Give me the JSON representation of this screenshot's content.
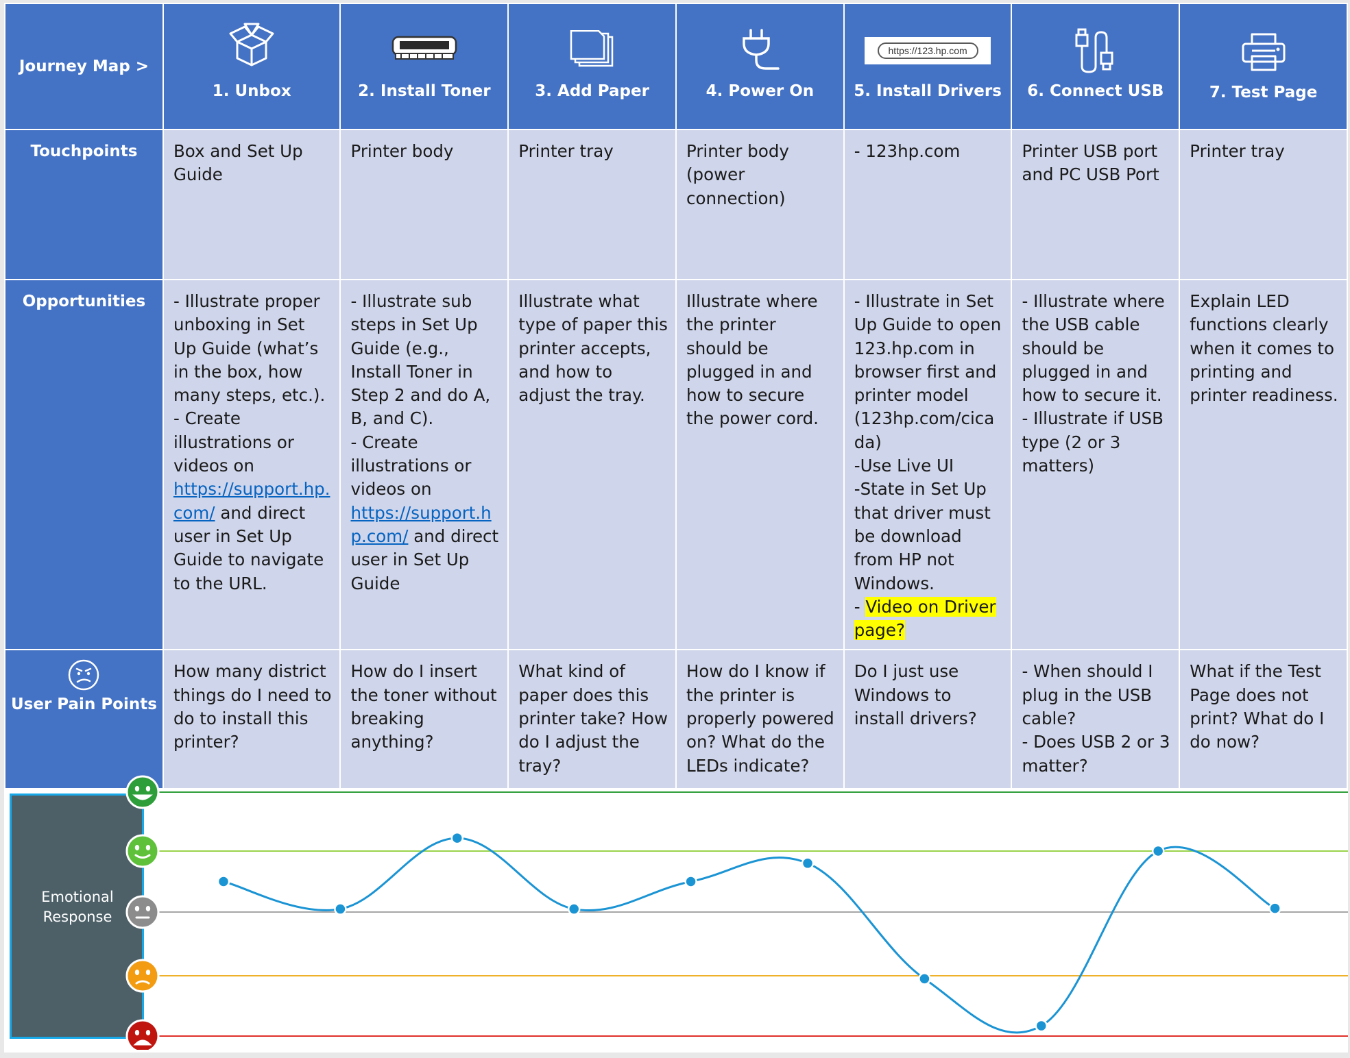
{
  "header": {
    "journey_label": "Journey Map >",
    "steps": [
      {
        "label": "1.  Unbox",
        "icon": "box-icon"
      },
      {
        "label": "2.  Install Toner",
        "icon": "toner-cartridge-icon"
      },
      {
        "label": "3.  Add Paper",
        "icon": "paper-stack-icon"
      },
      {
        "label": "4.  Power On",
        "icon": "power-plug-icon"
      },
      {
        "label": "5.  Install Drivers",
        "icon": "url-bar-icon",
        "url_text": "https://123.hp.com"
      },
      {
        "label": "6.  Connect USB",
        "icon": "usb-cable-icon"
      },
      {
        "label": "7. Test Page",
        "icon": "printer-icon"
      }
    ]
  },
  "rows": {
    "touchpoints": {
      "label": "Touchpoints",
      "cells": [
        "Box and Set Up Guide",
        "Printer body",
        "Printer tray",
        "Printer body (power connection)",
        "- 123hp.com",
        "Printer USB port and PC USB Port",
        "Printer tray"
      ]
    },
    "opportunities": {
      "label": "Opportunities",
      "cells": [
        {
          "lines": [
            "- Illustrate proper unboxing in Set Up Guide (what’s in the box, how many steps, etc.).",
            "-  Create illustrations or videos on "
          ],
          "link": "https://support.hp.com/",
          "after": " and direct user in Set Up Guide to navigate to the URL."
        },
        {
          "lines": [
            "- Illustrate sub steps in Set Up Guide (e.g., Install Toner in Step 2 and do A, B, and C).",
            "- Create illustrations or videos on "
          ],
          "link": "https://support.hp.com/",
          "after": " and direct user in Set Up Guide"
        },
        {
          "text": "Illustrate what type of paper this printer accepts, and how to adjust the tray."
        },
        {
          "text": "Illustrate where the printer should be plugged in and how to secure the power cord."
        },
        {
          "lines": [
            "- Illustrate in Set Up Guide to open 123.hp.com in browser first and printer model (123hp.com/cicada)",
            "-Use Live UI",
            "-State in Set Up that driver must be download from HP not Windows."
          ],
          "prefix": "- ",
          "highlight": "Video on Driver page?"
        },
        {
          "lines": [
            "- Illustrate where the USB cable should be plugged in and how to secure it.",
            "- Illustrate if USB type (2 or 3 matters)"
          ]
        },
        {
          "text": "Explain LED functions clearly when it comes to printing and printer readiness."
        }
      ]
    },
    "pain_points": {
      "label": "User Pain Points",
      "icon": "worried-face-icon",
      "cells": [
        "How many district things do I need to do to install this printer?",
        "How do I insert the toner without breaking anything?",
        "What kind of paper does this printer take? How do I adjust the tray?",
        "How do I know if the printer is properly powered on? What do the LEDs indicate?",
        "Do I just use Windows to install drivers?",
        [
          "- When should I plug in the USB cable?",
          "- Does USB 2 or 3 matter?"
        ],
        "What if the Test Page does not print? What do I do now?"
      ]
    }
  },
  "emotion": {
    "label_line1": "Emotional",
    "label_line2": "Response",
    "levels": [
      {
        "name": "very-happy",
        "color": "#2e9e3a",
        "line": "#2e9e3a"
      },
      {
        "name": "happy",
        "color": "#5fc13a",
        "line": "#9ad34a"
      },
      {
        "name": "neutral",
        "color": "#8c8c8c",
        "line": "#a6a6a6"
      },
      {
        "name": "unhappy",
        "color": "#f39c12",
        "line": "#f0b12a"
      },
      {
        "name": "angry",
        "color": "#c0150f",
        "line": "#e0302a"
      }
    ],
    "line_color": "#1b94d4"
  },
  "chart_data": {
    "type": "line",
    "title": "",
    "xlabel": "",
    "ylabel": "Emotional Response",
    "y_scale": "5 (very happy) to 1 (angry)",
    "ylim": [
      1,
      5
    ],
    "series": [
      {
        "points": [
          {
            "x": 1.0,
            "y": 3.5
          },
          {
            "x": 2.0,
            "y": 3.05
          },
          {
            "x": 3.0,
            "y": 4.22
          },
          {
            "x": 4.0,
            "y": 3.05
          },
          {
            "x": 5.0,
            "y": 3.5
          },
          {
            "x": 6.0,
            "y": 3.8
          },
          {
            "x": 7.0,
            "y": 1.95
          },
          {
            "x": 8.0,
            "y": 1.17
          },
          {
            "x": 9.0,
            "y": 4.0
          },
          {
            "x": 10.0,
            "y": 3.06
          }
        ]
      }
    ]
  }
}
